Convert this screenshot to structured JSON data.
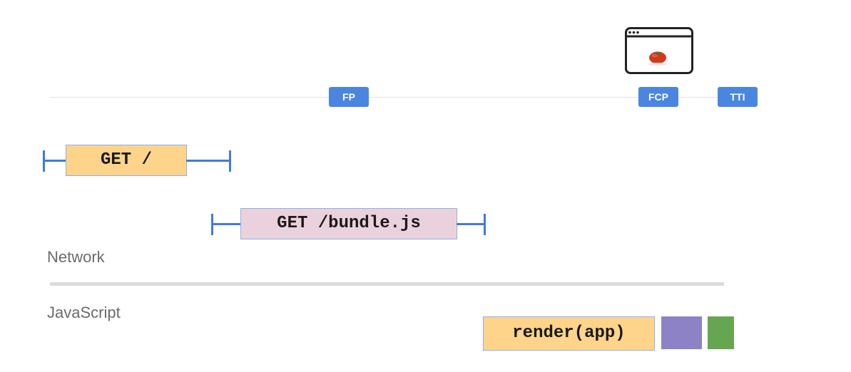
{
  "timeline": {
    "markers": {
      "fp": "FP",
      "fcp": "FCP",
      "tti": "TTI"
    },
    "screenshot_icon": "browser-window-with-tomato-icon"
  },
  "network": {
    "label": "Network",
    "requests": [
      {
        "label": "GET /",
        "color": "#fdd48a"
      },
      {
        "label": "GET /bundle.js",
        "color": "#ead2dc"
      }
    ]
  },
  "javascript": {
    "label": "JavaScript",
    "tasks": [
      {
        "label": "render(app)",
        "color": "#fdd48a"
      },
      {
        "label": "",
        "color": "#8e82c6"
      },
      {
        "label": "",
        "color": "#67a651"
      }
    ]
  },
  "colors": {
    "marker": "#4a86e0",
    "whisker": "#3f7be0"
  }
}
